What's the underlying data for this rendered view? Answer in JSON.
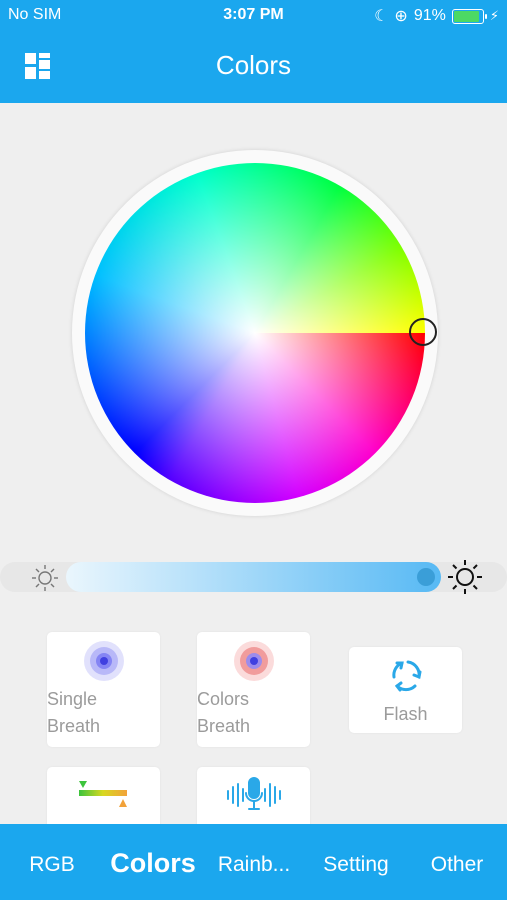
{
  "status_bar": {
    "carrier": "No SIM",
    "time": "3:07 PM",
    "battery": "91%",
    "battery_level": 0.91
  },
  "header": {
    "title": "Colors",
    "menu_icon": "grid-menu-icon"
  },
  "color_wheel": {
    "selected_color": "#ff0000"
  },
  "brightness": {
    "value": 0.95,
    "min_icon": "sun-outline-icon",
    "max_icon": "sun-icon"
  },
  "modes": [
    {
      "line1": "Single",
      "line2": "Breath",
      "icon": "single-breath-icon"
    },
    {
      "line1": "Colors",
      "line2": "Breath",
      "icon": "colors-breath-icon"
    },
    {
      "label": "Flash",
      "icon": "flash-cycle-icon"
    },
    {
      "icon": "jump-gradient-icon"
    },
    {
      "icon": "music-mic-icon"
    }
  ],
  "tabs": [
    {
      "label": "RGB"
    },
    {
      "label": "Colors",
      "active": true
    },
    {
      "label": "Rainb..."
    },
    {
      "label": "Setting"
    },
    {
      "label": "Other"
    }
  ],
  "colors": {
    "accent": "#1ba7ee",
    "background": "#efefef",
    "card_text": "#9b9b9b"
  }
}
